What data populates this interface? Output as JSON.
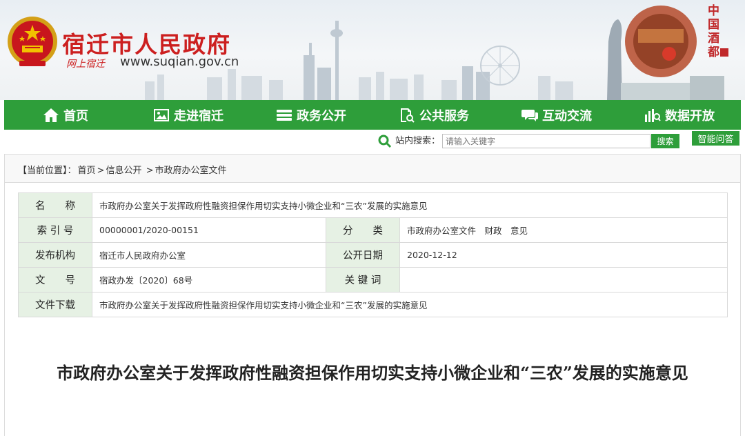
{
  "header": {
    "site_name": "宿迁市人民政府",
    "slogan": "网上宿迁",
    "url": "www.suqian.gov.cn",
    "deco_vertical": "中国酒都"
  },
  "nav": {
    "items": [
      {
        "label": "首页",
        "icon": "home-icon"
      },
      {
        "label": "走进宿迁",
        "icon": "picture-icon"
      },
      {
        "label": "政务公开",
        "icon": "stack-icon"
      },
      {
        "label": "公共服务",
        "icon": "document-search-icon"
      },
      {
        "label": "互动交流",
        "icon": "chat-icon"
      },
      {
        "label": "数据开放",
        "icon": "data-chart-icon"
      }
    ]
  },
  "search": {
    "label": "站内搜索：",
    "placeholder": "请输入关键字",
    "button": "搜索",
    "qa_button": "智能问答"
  },
  "breadcrumb": {
    "prefix": "【当前位置】：",
    "items": [
      "首页",
      "信息公开",
      "市政府办公室文件"
    ],
    "sep": ">"
  },
  "meta": {
    "name_label": "名　　称",
    "name_value": "市政府办公室关于发挥政府性融资担保作用切实支持小微企业和“三农”发展的实施意见",
    "index_label": "索 引 号",
    "index_value": "00000001/2020-00151",
    "category_label": "分　　类",
    "category_value": "市政府办公室文件　财政　意见",
    "issuer_label": "发布机构",
    "issuer_value": "宿迁市人民政府办公室",
    "date_label": "公开日期",
    "date_value": "2020-12-12",
    "docno_label": "文　　号",
    "docno_value": "宿政办发〔2020〕68号",
    "keywords_label": "关 键 词",
    "keywords_value": "",
    "download_label": "文件下载",
    "download_value": "市政府办公室关于发挥政府性融资担保作用切实支持小微企业和“三农”发展的实施意见"
  },
  "document": {
    "title": "市政府办公室关于发挥政府性融资担保作用切实支持小微企业和“三农”发展的实施意见"
  },
  "colors": {
    "nav_green": "#2e9e3a",
    "brand_red": "#cc1f1f",
    "label_bg": "#e6f1e4"
  }
}
